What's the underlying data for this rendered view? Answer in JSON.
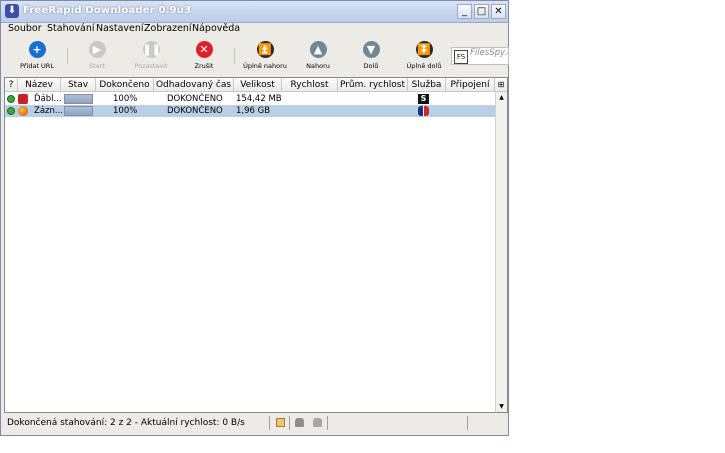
{
  "window": {
    "title": "FreeRapid Downloader 0.9u3",
    "controls": {
      "minimize": "_",
      "maximize": "□",
      "close": "✕"
    }
  },
  "menu": [
    "Soubor",
    "Stahování",
    "Nastavení",
    "Zobrazení",
    "Nápověda"
  ],
  "toolbar": {
    "buttons": [
      {
        "label": "Přidat URL",
        "icon": "plus-icon",
        "color": "#1a6fd4",
        "enabled": true
      },
      {
        "label": "Start",
        "icon": "play-icon",
        "color": "#bdbdbd",
        "enabled": false
      },
      {
        "label": "Pozastavit",
        "icon": "pause-icon",
        "color": "#bdbdbd",
        "enabled": false
      },
      {
        "label": "Zrušit",
        "icon": "x-icon",
        "color": "#e0212b",
        "enabled": true
      },
      {
        "label": "Úplně nahoru",
        "icon": "top-icon",
        "color": "#222a33",
        "enabled": true
      },
      {
        "label": "Nahoru",
        "icon": "up-icon",
        "color": "#6f8797",
        "enabled": true
      },
      {
        "label": "Dolů",
        "icon": "down-icon",
        "color": "#6f8797",
        "enabled": true
      },
      {
        "label": "Úplně dolů",
        "icon": "bottom-icon",
        "color": "#222a33",
        "enabled": true
      }
    ],
    "filesspy": {
      "logo": "FS",
      "text": "FilesSpy.c"
    }
  },
  "table": {
    "columns": [
      "?",
      "Název",
      "Stav",
      "Dokončeno",
      "Odhadovaný čas",
      "Velikost",
      "Rychlost",
      "Prům. rychlost",
      "Služba",
      "Připojení"
    ],
    "corner_icon": "⊞",
    "rows": [
      {
        "name": "Ďábl...",
        "progress": 1.0,
        "done": "100%",
        "eta": "DOKONČENO",
        "size": "154,42 MB",
        "speed": "",
        "avg_speed": "",
        "service": "S",
        "connection": "",
        "selected": false,
        "site_color": "#c8232c"
      },
      {
        "name": "Zázn...",
        "progress": 1.0,
        "done": "100%",
        "eta": "DOKONČENO",
        "size": "1,96 GB",
        "speed": "",
        "avg_speed": "",
        "service": "",
        "connection": "",
        "selected": true,
        "site_color": "#e8761e"
      }
    ]
  },
  "statusbar": {
    "text": "Dokončená stahování: 2 z 2 - Aktuální rychlost: 0 B/s"
  }
}
